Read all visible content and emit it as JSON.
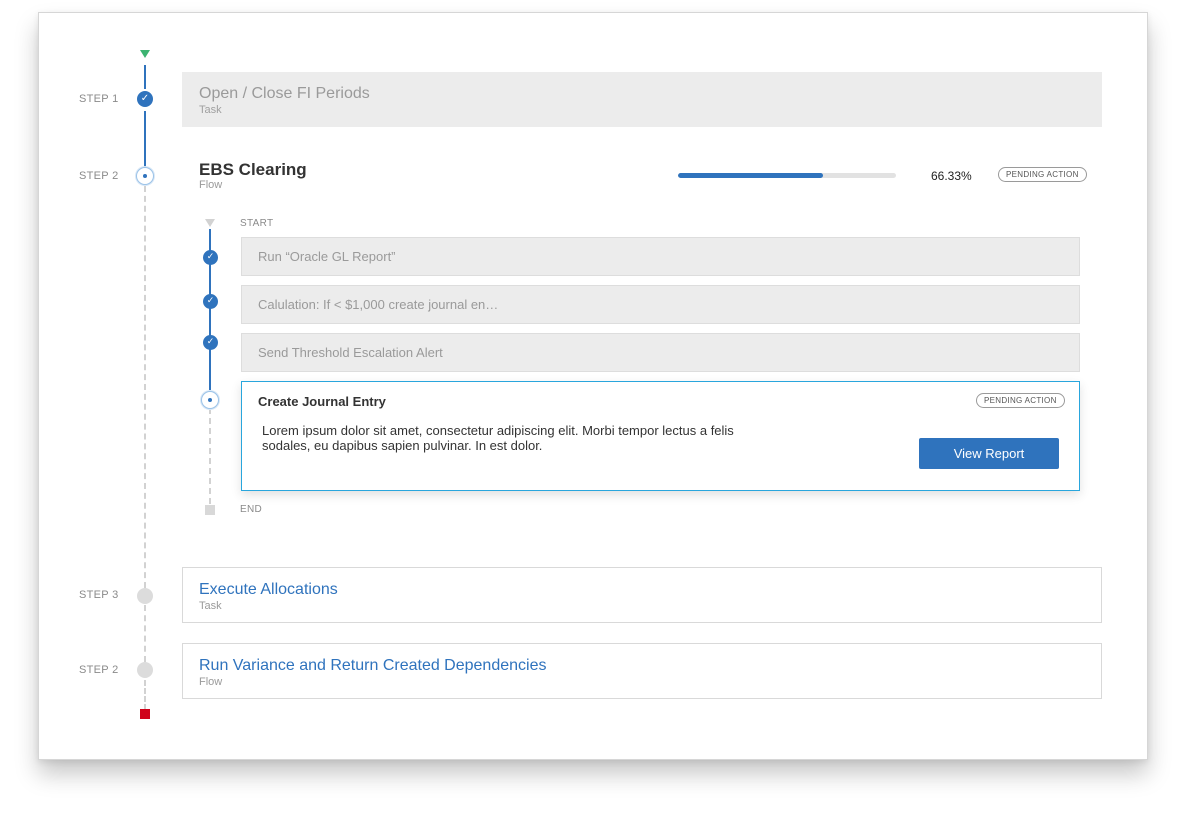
{
  "colors": {
    "accent": "#2f73bd",
    "active_border": "#29a6dd",
    "start_marker": "#3cb371",
    "end_marker": "#d0021b",
    "done_card_bg": "#ececec"
  },
  "steps": [
    {
      "label": "STEP 1",
      "title": "Open / Close FI Periods",
      "type": "Task",
      "status": "complete"
    },
    {
      "label": "STEP 2",
      "title": "EBS Clearing",
      "type": "Flow",
      "status": "in-progress",
      "progress_text": "66.33%",
      "progress_fraction": 0.6633,
      "badge": "PENDING ACTION"
    },
    {
      "label": "STEP 3",
      "title": "Execute Allocations",
      "type": "Task",
      "status": "not-started"
    },
    {
      "label": "STEP 2",
      "title": "Run Variance and Return Created Dependencies",
      "type": "Flow",
      "status": "not-started"
    }
  ],
  "subflow": {
    "start_label": "START",
    "end_label": "END",
    "items": [
      {
        "title": "Run “Oracle GL Report”",
        "status": "complete"
      },
      {
        "title": "Calulation: If < $1,000 create journal en…",
        "status": "complete"
      },
      {
        "title": "Send Threshold Escalation Alert",
        "status": "complete"
      }
    ],
    "active": {
      "title": "Create Journal Entry",
      "badge": "PENDING ACTION",
      "description": "Lorem ipsum dolor sit amet, consectetur adipiscing elit. Morbi tempor lectus a felis sodales, eu dapibus sapien pulvinar. In est dolor.",
      "button_label": "View Report"
    }
  },
  "icons": {
    "check": "✓",
    "start": "triangle-down-icon",
    "end": "square-icon"
  }
}
